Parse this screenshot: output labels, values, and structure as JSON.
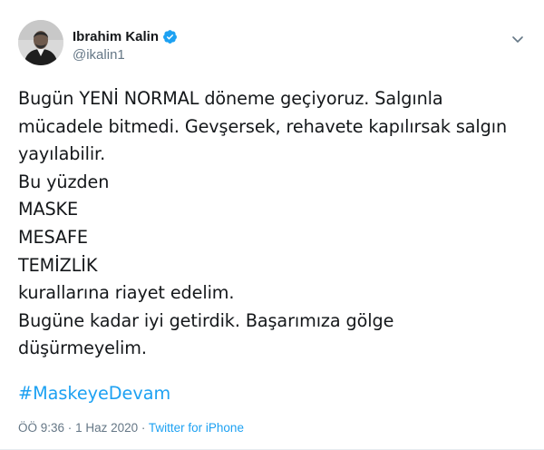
{
  "author": {
    "name": "Ibrahim Kalin",
    "handle": "@ikalin1",
    "verified": true,
    "avatar_icon": "profile-photo"
  },
  "tweet": {
    "lines": [
      "Bugün YENİ NORMAL döneme geçiyoruz. Salgınla",
      "mücadele bitmedi. Gevşersek, rehavete kapılırsak salgın",
      "yayılabilir.",
      "Bu yüzden",
      "MASKE",
      "MESAFE",
      "TEMİZLİK",
      "kurallarına riayet edelim.",
      "Bugüne kadar iyi getirdik. Başarımıza gölge",
      "düşürmeyelim."
    ],
    "hashtag": "#MaskeyeDevam",
    "time": "ÖÖ 9:36",
    "separator": "·",
    "date": "1 Haz 2020",
    "source": "Twitter for iPhone"
  },
  "colors": {
    "link": "#1da1f2",
    "secondary_text": "#657786",
    "verified_badge": "#1da1f2"
  }
}
